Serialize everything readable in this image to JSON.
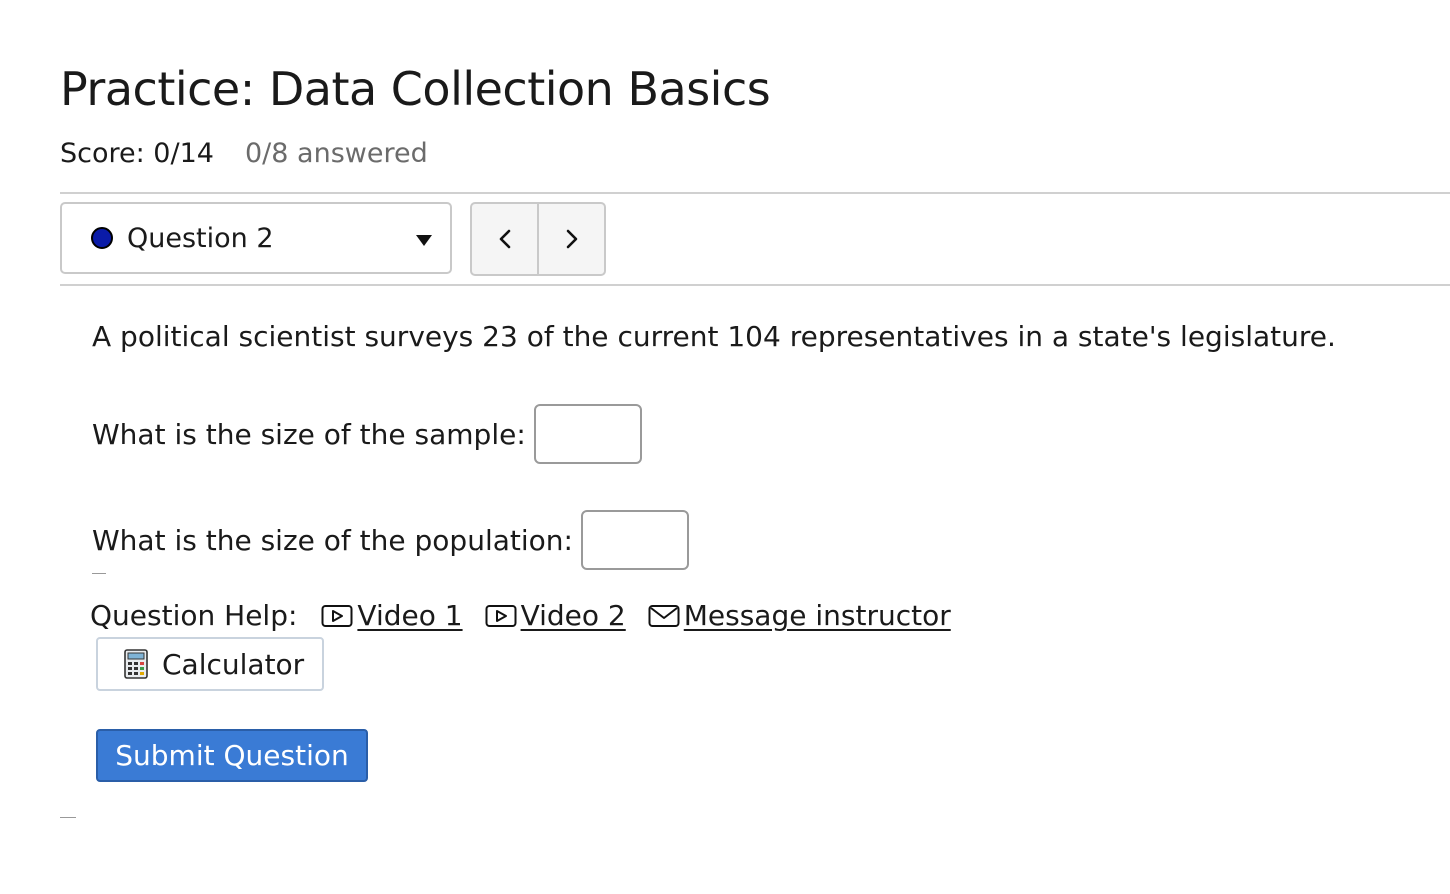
{
  "header": {
    "title": "Practice: Data Collection Basics",
    "score": "Score: 0/14",
    "answered": "0/8 answered"
  },
  "question_nav": {
    "selected": "Question 2",
    "status_color": "#0a1ba8"
  },
  "question": {
    "prompt": "A political scientist surveys 23 of the current 104 representatives in a state's legislature.",
    "parts": [
      {
        "label": "What is the size of the sample:",
        "value": ""
      },
      {
        "label": "What is the size of the population:",
        "value": ""
      }
    ]
  },
  "help": {
    "label": "Question Help:",
    "links": [
      "Video 1",
      "Video 2",
      "Message instructor"
    ],
    "calculator": "Calculator"
  },
  "actions": {
    "submit": "Submit Question",
    "submit_color": "#3a7bd5"
  }
}
